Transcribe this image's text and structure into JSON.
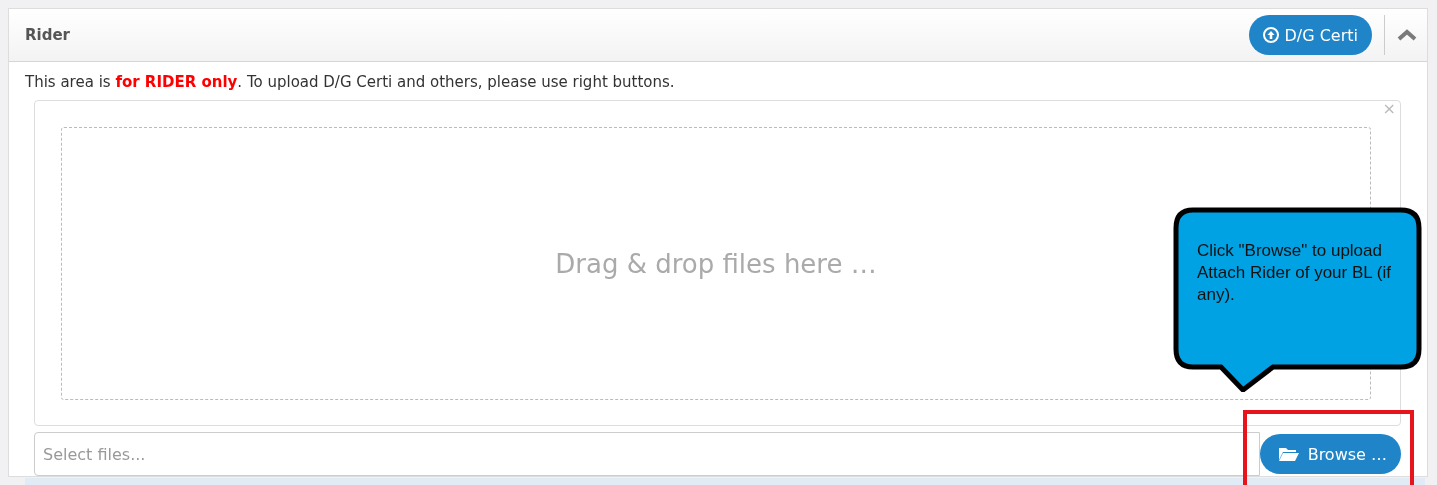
{
  "panel": {
    "title": "Rider",
    "upload_button": "D/G Certi"
  },
  "notice": "This area is **for RIDER only**. To upload D/G Certi and others, please use right buttons.",
  "dropzone": {
    "close": "×",
    "text": "Drag & drop files here …"
  },
  "file_input": {
    "placeholder": "Select files..."
  },
  "browse_button": "Browse …",
  "callout": {
    "text": "Click \"Browse\" to upload Attach Rider of your BL (if any)."
  }
}
